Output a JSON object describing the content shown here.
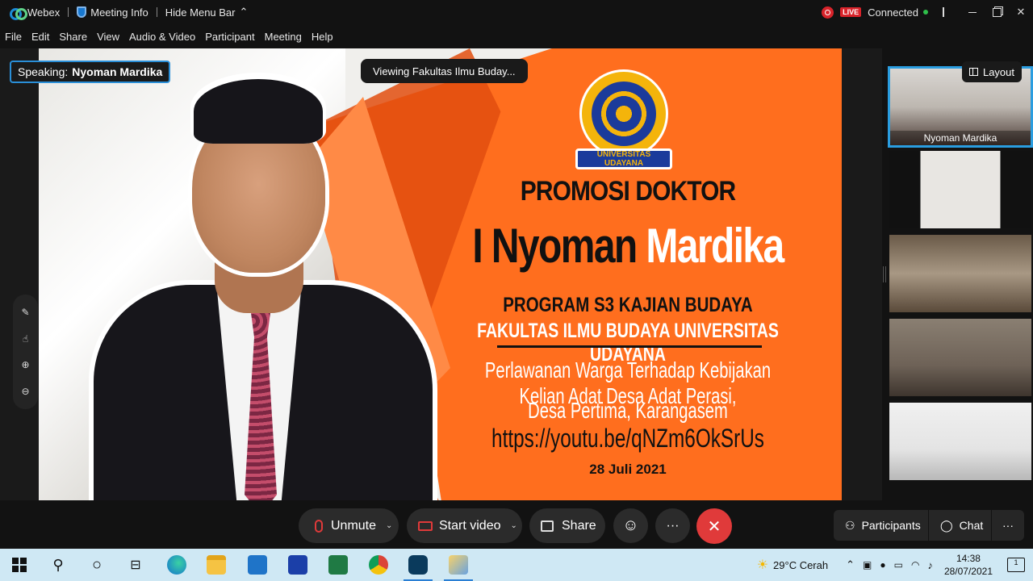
{
  "titlebar": {
    "app_name": "Webex",
    "meeting_info": "Meeting Info",
    "hide_menu_bar": "Hide Menu Bar",
    "live_badge": "LIVE",
    "status": "Connected"
  },
  "menu": [
    "File",
    "Edit",
    "Share",
    "View",
    "Audio & Video",
    "Participant",
    "Meeting",
    "Help"
  ],
  "stage": {
    "speaking_label": "Speaking:",
    "speaking_name": "Nyoman Mardika",
    "viewing": "Viewing Fakultas Ilmu Buday..."
  },
  "slide": {
    "logo_text": "UNIVERSITAS UDAYANA",
    "title": "PROMOSI DOKTOR",
    "name_part1": "I Nyoman",
    "name_part2": "Mardika",
    "program": "PROGRAM S3 KAJIAN BUDAYA",
    "faculty": "FAKULTAS ILMU BUDAYA UNIVERSITAS UDAYANA",
    "thesis_line1": "Perlawanan Warga Terhadap Kebijakan Kelian Adat Desa Adat Perasi,",
    "thesis_line2": "Desa Pertima, Karangasem",
    "link": "https://youtu.be/qNZm6OkSrUs",
    "date": "28 Juli 2021"
  },
  "side_panel": {
    "layout_label": "Layout",
    "tiles": [
      {
        "name": "Nyoman Mardika"
      }
    ]
  },
  "controls": {
    "unmute": "Unmute",
    "start_video": "Start video",
    "share": "Share",
    "more": "···",
    "end": "✕",
    "participants": "Participants",
    "chat": "Chat",
    "more_right": "···"
  },
  "taskbar": {
    "weather": "29°C  Cerah",
    "time": "14:38",
    "date": "28/07/2021",
    "notification_count": "1"
  },
  "colors": {
    "accent_blue": "#2a8fd8",
    "end_red": "#e03a3a",
    "slide_orange": "#ff6e1e",
    "taskbar": "#cfe8f4"
  }
}
